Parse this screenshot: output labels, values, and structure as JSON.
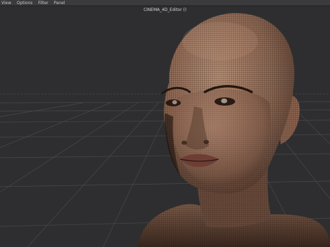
{
  "menubar": {
    "items": [
      {
        "label": "View"
      },
      {
        "label": "Options"
      },
      {
        "label": "Filter"
      },
      {
        "label": "Panel"
      }
    ]
  },
  "viewport": {
    "title": "CINEMA_4D_Editor ()",
    "subject": "wireframe-head-model",
    "colors": {
      "background": "#2e2e30",
      "grid": "#606064",
      "skin": "#a07a62",
      "wire": "#1e1712"
    }
  }
}
